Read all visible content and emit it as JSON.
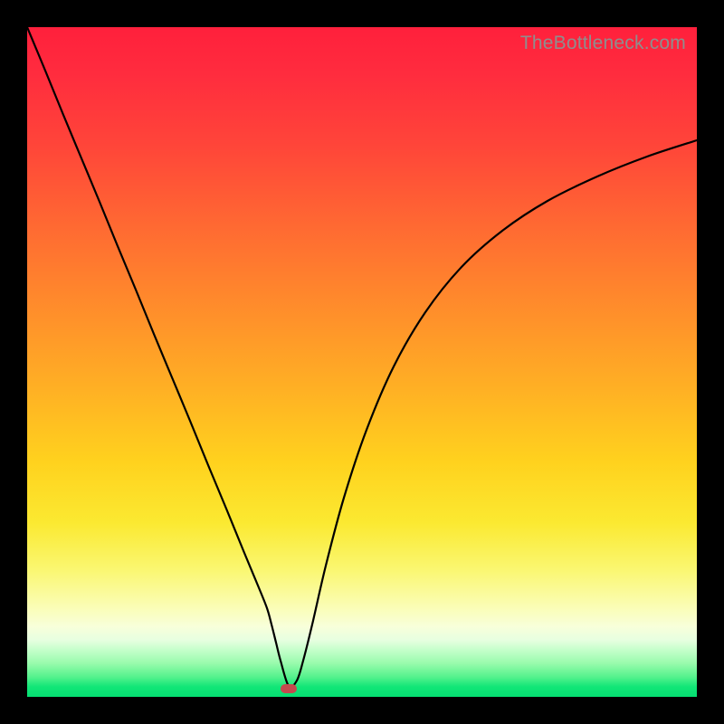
{
  "watermark": "TheBottleneck.com",
  "chart_data": {
    "type": "line",
    "title": "",
    "xlabel": "",
    "ylabel": "",
    "xrange": [
      0,
      740
    ],
    "yrange": [
      0,
      740
    ],
    "series": [
      {
        "name": "curve",
        "x": [
          0,
          20,
          40,
          60,
          80,
          100,
          120,
          140,
          160,
          180,
          200,
          220,
          240,
          255,
          265,
          270,
          275,
          280,
          289,
          298,
          305,
          315,
          330,
          350,
          375,
          405,
          440,
          480,
          525,
          575,
          630,
          685,
          740
        ],
        "y": [
          740,
          692,
          643,
          595,
          547,
          498,
          450,
          401,
          353,
          305,
          256,
          208,
          159,
          123,
          98,
          80,
          60,
          40,
          12,
          18,
          40,
          80,
          145,
          220,
          295,
          365,
          425,
          475,
          515,
          548,
          575,
          597,
          615
        ]
      }
    ],
    "marker": {
      "x": 289,
      "y": 9
    },
    "gradient_bands": [
      "#ff203c",
      "#ff2c3e",
      "#ff4639",
      "#ff6a32",
      "#ff8d2b",
      "#ffb024",
      "#ffd21e",
      "#fbe931",
      "#faf771",
      "#fafdb4",
      "#f8ffda",
      "#e7ffe0",
      "#c5ffcb",
      "#98fbac",
      "#56f28d",
      "#11e677",
      "#06df72"
    ]
  }
}
